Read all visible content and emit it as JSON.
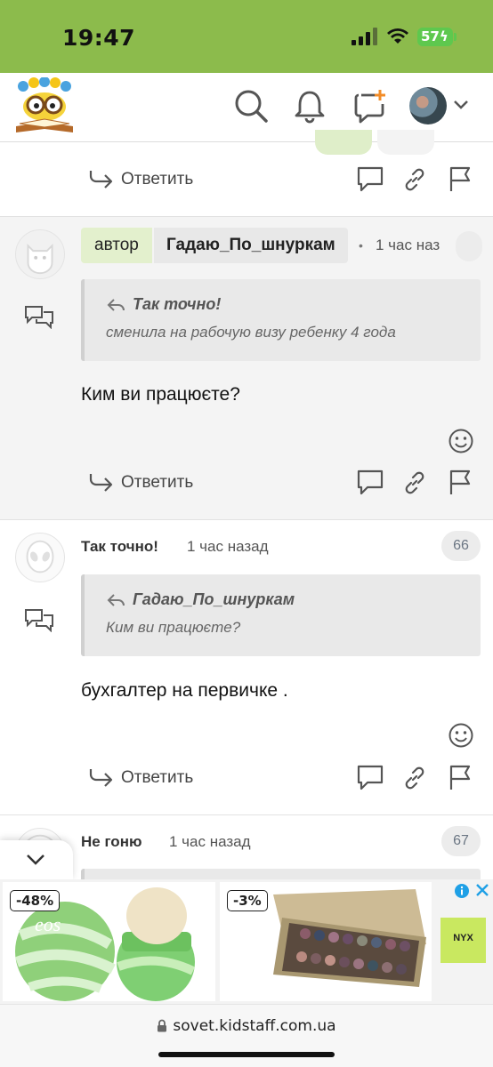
{
  "status_bar": {
    "time": "19:47",
    "battery": "57"
  },
  "comments": [
    {
      "author_badge": "автор",
      "author": "Гадаю_По_шнуркам",
      "time_ago": "1 час наз",
      "quote": {
        "name": "Так точно!",
        "text": "сменила на рабочую визу ребенку 4 года"
      },
      "body": "Ким ви працюєте?"
    },
    {
      "author": "Так точно!",
      "time_ago": "1 час назад",
      "number": "66",
      "quote": {
        "name": "Гадаю_По_шнуркам",
        "text": "Ким ви працюєте?"
      },
      "body": "бухгалтер на первичке ."
    },
    {
      "author": "Не гоню",
      "time_ago": "1 час назад",
      "number": "67"
    }
  ],
  "actions": {
    "reply_label": "Ответить"
  },
  "ads": [
    {
      "discount": "-48%",
      "brand": "eos"
    },
    {
      "discount": "-3%"
    }
  ],
  "ad_logo": "NYX",
  "browser": {
    "url": "sovet.kidstaff.com.ua"
  },
  "colors": {
    "brand_green": "#8cbb4c",
    "author_badge_bg": "#e3f0cd",
    "battery": "#5ec84e"
  }
}
